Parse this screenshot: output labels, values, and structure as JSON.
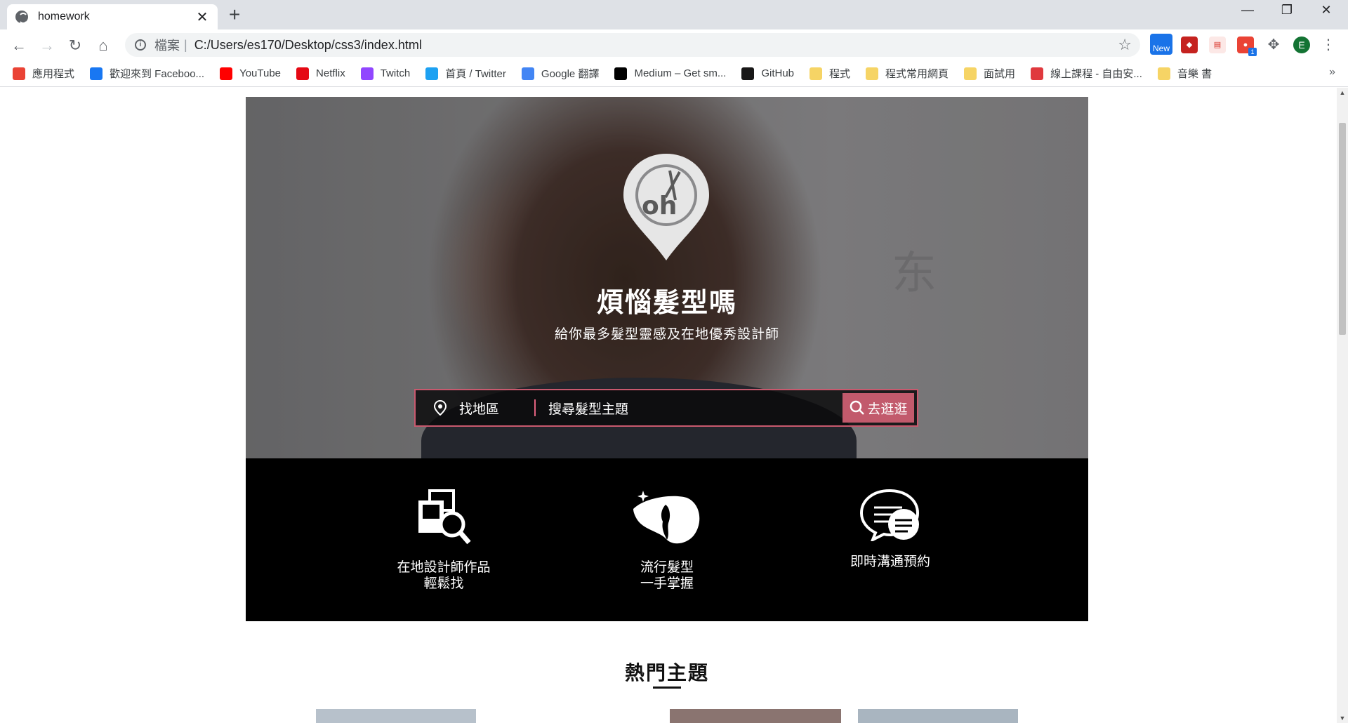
{
  "browser": {
    "tab_title": "homework",
    "tab_close": "✕",
    "new_tab": "+",
    "url_scheme": "檔案",
    "url_sep": "|",
    "url": "C:/Users/es170/Desktop/css3/index.html",
    "ext_new_label": "New",
    "ext_badge": "1",
    "profile_initial": "E",
    "window_minimize": "—",
    "window_restore": "❐",
    "window_close": "✕"
  },
  "bookmarks": [
    {
      "label": "應用程式",
      "icon": "apps-grid-icon",
      "color": "#ea4335"
    },
    {
      "label": "歡迎來到 Faceboo...",
      "icon": "facebook-icon",
      "color": "#1877f2"
    },
    {
      "label": "YouTube",
      "icon": "youtube-icon",
      "color": "#ff0000"
    },
    {
      "label": "Netflix",
      "icon": "netflix-icon",
      "color": "#e50914"
    },
    {
      "label": "Twitch",
      "icon": "twitch-icon",
      "color": "#9146ff"
    },
    {
      "label": "首頁 / Twitter",
      "icon": "twitter-icon",
      "color": "#1da1f2"
    },
    {
      "label": "Google 翻譯",
      "icon": "google-translate-icon",
      "color": "#4285f4"
    },
    {
      "label": "Medium – Get sm...",
      "icon": "medium-icon",
      "color": "#000000"
    },
    {
      "label": "GitHub",
      "icon": "github-icon",
      "color": "#181717"
    },
    {
      "label": "程式",
      "icon": "folder-icon",
      "color": "#f6d465"
    },
    {
      "label": "程式常用網頁",
      "icon": "folder-icon",
      "color": "#f6d465"
    },
    {
      "label": "面試用",
      "icon": "folder-icon",
      "color": "#f6d465"
    },
    {
      "label": "線上課程 - 自由安...",
      "icon": "course-icon",
      "color": "#e0393e"
    },
    {
      "label": "音樂 書",
      "icon": "folder-icon",
      "color": "#f6d465"
    }
  ],
  "bookmarks_more": "»",
  "hero": {
    "title": "煩惱髮型嗎",
    "subtitle": "給你最多髮型靈感及在地優秀設計師",
    "watermark": "东"
  },
  "search": {
    "region_label": "找地區",
    "keyword_placeholder": "搜尋髮型主題",
    "button_label": "去逛逛"
  },
  "features": [
    {
      "line1": "在地設計師作品",
      "line2": "輕鬆找",
      "icon": "designer-search-icon"
    },
    {
      "line1": "流行髮型",
      "line2": "一手掌握",
      "icon": "hair-style-icon"
    },
    {
      "line1": "即時溝通預約",
      "line2": "",
      "icon": "chat-bubble-icon"
    }
  ],
  "section": {
    "title": "熱門主題"
  },
  "colors": {
    "accent": "#c25a6c",
    "accent_border": "#c8596e",
    "feature_bg": "#000000"
  }
}
